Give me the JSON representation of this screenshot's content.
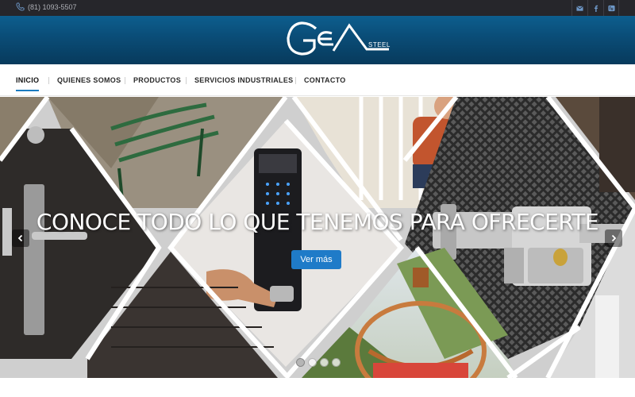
{
  "topbar": {
    "phone": "(81) 1093-5507",
    "social_icons": [
      "mail-icon",
      "facebook-icon",
      "youtube-icon"
    ]
  },
  "header": {
    "logo_text": "GEA",
    "logo_sub": "STEEL"
  },
  "nav": {
    "items": [
      {
        "label": "INICIO",
        "active": true
      },
      {
        "label": "QUIENES SOMOS",
        "active": false
      },
      {
        "label": "PRODUCTOS",
        "active": false
      },
      {
        "label": "SERVICIOS INDUSTRIALES",
        "active": false
      },
      {
        "label": "CONTACTO",
        "active": false
      }
    ]
  },
  "hero": {
    "headline": "CONOCE TODO LO QUE TENEMOS PARA OFRECERTE",
    "cta_label": "Ver más",
    "slide_count": 4,
    "active_slide": 1
  },
  "colors": {
    "topbar": "#26262b",
    "header": "#0a4c76",
    "accent": "#1f7bc8"
  }
}
